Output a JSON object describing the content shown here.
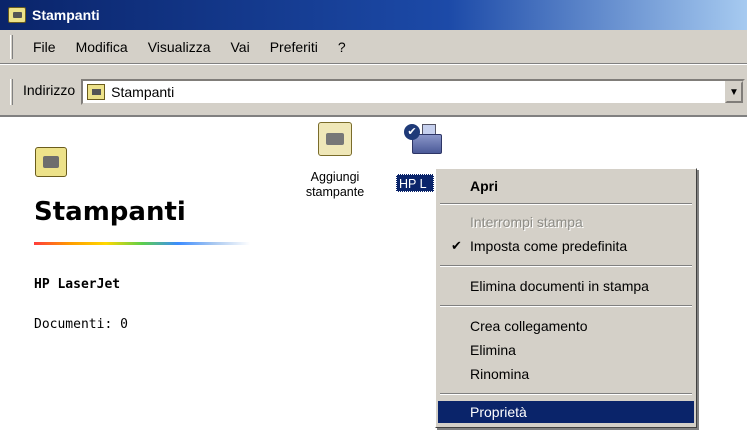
{
  "window": {
    "title": "Stampanti"
  },
  "menu": [
    "File",
    "Modifica",
    "Visualizza",
    "Vai",
    "Preferiti",
    "?"
  ],
  "address": {
    "label": "Indirizzo",
    "value": "Stampanti"
  },
  "left_pane": {
    "title": "Stampanti",
    "printer_name": "HP LaserJet",
    "documents": "Documenti: 0"
  },
  "icons": {
    "add_label": "Aggiungi stampante",
    "hp_label": "HP L"
  },
  "context_menu": {
    "open": "Apri",
    "pause": "Interrompi stampa",
    "set_default": "Imposta come predefinita",
    "purge": "Elimina documenti in stampa",
    "shortcut": "Crea collegamento",
    "delete": "Elimina",
    "rename": "Rinomina",
    "properties": "Proprietà"
  },
  "colors": {
    "selection": "#0a246a",
    "face": "#d4d0c8"
  }
}
